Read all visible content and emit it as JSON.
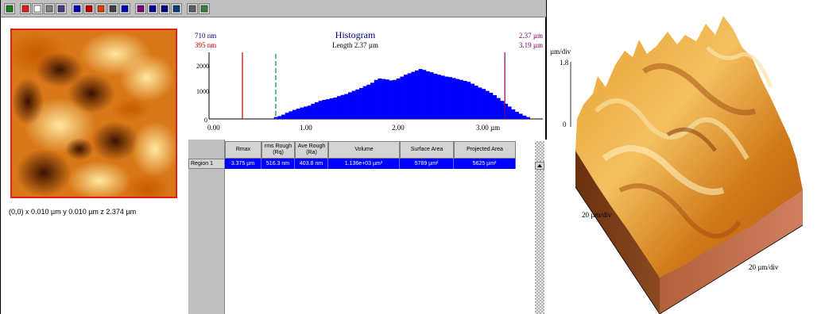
{
  "toolbar": {
    "buttons": [
      "pencil-icon",
      "red-square-icon",
      "rect-select-icon",
      "zoom-icon",
      "profile-icon",
      "phi-icon",
      "color-table-icon",
      "filter-icon",
      "print-icon",
      "bar-stats-icon",
      "settings-icon",
      "light-source-icon",
      "view-3d-icon",
      "rotate-icon",
      "table-icon",
      "grid-icon"
    ]
  },
  "image_panel": {
    "coordinates_text": "(0,0) x 0.010 µm  y 0.010 µm  z 2.374 µm"
  },
  "histogram": {
    "title": "Histogram",
    "subtitle": "Length 2.37 µm",
    "left_label_top": "710 nm",
    "left_label_bottom": "395 nm",
    "right_label_top": "2.37 µm",
    "right_label_bottom": "3.19 µm",
    "y_ticks": [
      "2000",
      "1000",
      "0"
    ],
    "x_ticks": [
      "0.00",
      "1.00",
      "2.00",
      "3.00 µm"
    ],
    "colors": {
      "bars": "#0000ff",
      "left_marker": "#c00000",
      "mid_marker": "#008080",
      "right_marker": "#800060",
      "title": "#000080"
    },
    "chart_data": {
      "type": "bar",
      "ylim": [
        0,
        2600
      ],
      "xlim": [
        0,
        3.6
      ],
      "bins": [
        0.7,
        0.74,
        0.78,
        0.82,
        0.86,
        0.9,
        0.94,
        0.98,
        1.02,
        1.06,
        1.1,
        1.14,
        1.18,
        1.22,
        1.26,
        1.3,
        1.34,
        1.38,
        1.42,
        1.46,
        1.5,
        1.54,
        1.58,
        1.62,
        1.66,
        1.7,
        1.74,
        1.78,
        1.82,
        1.86,
        1.9,
        1.94,
        1.98,
        2.02,
        2.06,
        2.1,
        2.14,
        2.18,
        2.22,
        2.26,
        2.3,
        2.34,
        2.38,
        2.42,
        2.46,
        2.5,
        2.54,
        2.58,
        2.62,
        2.66,
        2.7,
        2.74,
        2.78,
        2.82,
        2.86,
        2.9,
        2.94,
        2.98,
        3.02,
        3.06,
        3.1,
        3.14,
        3.18,
        3.22,
        3.26,
        3.3,
        3.34,
        3.38,
        3.42
      ],
      "values": [
        80,
        120,
        180,
        260,
        320,
        380,
        430,
        480,
        520,
        560,
        640,
        700,
        760,
        800,
        830,
        870,
        900,
        960,
        1010,
        1050,
        1120,
        1180,
        1240,
        1300,
        1380,
        1440,
        1520,
        1640,
        1700,
        1680,
        1660,
        1620,
        1640,
        1700,
        1780,
        1860,
        1920,
        1980,
        2040,
        2100,
        2060,
        2000,
        1960,
        1900,
        1860,
        1820,
        1780,
        1760,
        1720,
        1680,
        1640,
        1600,
        1560,
        1480,
        1400,
        1320,
        1260,
        1180,
        1100,
        1000,
        880,
        760,
        640,
        520,
        400,
        300,
        220,
        140,
        80
      ],
      "markers": [
        0.36,
        0.72,
        3.19
      ]
    }
  },
  "table": {
    "columns": [
      "Rmax",
      "rms Rough (Rq)",
      "Ave Rough (Ra)",
      "Volume",
      "Surface Area",
      "Projected Area"
    ],
    "row_label": "Region 1",
    "row_values": [
      "3.375 µm",
      "516.3 nm",
      "403.8 nm",
      "1.136e+03 µm³",
      "5789 µm²",
      "5625 µm²"
    ]
  },
  "render3d": {
    "z_label": "µm/div",
    "z_scale": "1.8",
    "z_zero": "0",
    "x_label": "20 µm/div",
    "y_label": "20 µm/div"
  }
}
